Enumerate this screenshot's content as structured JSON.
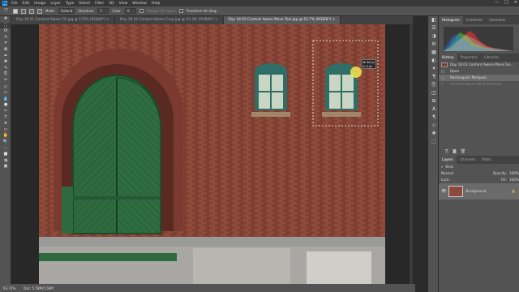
{
  "menubar": {
    "logo": "Ps",
    "items": [
      "File",
      "Edit",
      "Image",
      "Layer",
      "Type",
      "Select",
      "Filter",
      "3D",
      "View",
      "Window",
      "Help"
    ],
    "controls": [
      "—",
      "□",
      "✕"
    ]
  },
  "options": {
    "mode_label": "Mode:",
    "mode_value": "Extend",
    "structure_label": "Structure:",
    "structure_value": "7",
    "color_label": "Color:",
    "color_value": "0",
    "sample_all_layers": "Sample All Layers",
    "transform_on_drop": "Transform On Drop"
  },
  "tabs": [
    {
      "label": "Day 18 01 Content Aware Fill.jpg @ 170% (RGB/8*) ×",
      "active": false
    },
    {
      "label": "Day 18 02 Content Aware Crop.jpg @ 45.4% (RGB/8*) ×",
      "active": false
    },
    {
      "label": "Day 18 03 Content Aware Move Tool.jpg @ 63.7% (RGB/8*) ×",
      "active": true
    }
  ],
  "tools": [
    "move",
    "marquee",
    "lasso",
    "quick-select",
    "crop",
    "frame",
    "eyedropper",
    "healing",
    "brush",
    "clone",
    "history-brush",
    "eraser",
    "gradient",
    "blur",
    "dodge",
    "pen",
    "type",
    "path-select",
    "shape",
    "hand",
    "zoom",
    "more",
    "fg-bg",
    "mask",
    "screen-mode"
  ],
  "tool_glyphs": [
    "✥",
    "⬚",
    "ʘ",
    "✎",
    "⌗",
    "⊠",
    "✒",
    "✚",
    "✎",
    "⎘",
    "↶",
    "◇",
    "▭",
    "💧",
    "●",
    "✑",
    "T",
    "➤",
    "▭",
    "✋",
    "🔍",
    "…",
    "■",
    "◑",
    "▣"
  ],
  "selection_tooltip": {
    "w": "W: 84 px",
    "h": "H: 0 px"
  },
  "status": {
    "zoom": "63.72%",
    "doc": "Doc: 5.58M/5.58M"
  },
  "iconcol": [
    "◧",
    "☰",
    "◑",
    "⚙",
    "▦",
    "◐",
    "✦",
    "¶",
    "⎘",
    "◫",
    "⊞",
    "A",
    "¶",
    "◇",
    "✤",
    "⬚"
  ],
  "histogram_tabs": [
    "Histogram",
    "Gradients",
    "Swatches"
  ],
  "history_tabs": [
    "History",
    "Properties",
    "Libraries"
  ],
  "history_items": [
    {
      "label": "Day 18 03 Content Aware Move Too…",
      "type": "snapshot",
      "state": "normal"
    },
    {
      "label": "Open",
      "type": "step",
      "state": "normal"
    },
    {
      "label": "Rectangular Marquee",
      "type": "step",
      "state": "selected"
    },
    {
      "label": "Content-Aware Move Selection",
      "type": "step",
      "state": "faint"
    }
  ],
  "layers_tabs": [
    "Layers",
    "Channels",
    "Paths"
  ],
  "layers": {
    "kind_label": "Kind",
    "blend_mode": "Normal",
    "opacity_label": "Opacity:",
    "opacity_value": "100%",
    "lock_label": "Lock:",
    "fill_label": "Fill:",
    "fill_value": "100%",
    "items": [
      {
        "name": "Background",
        "locked": true
      }
    ]
  },
  "histogram_colors": [
    "#ff3030",
    "#30ff30",
    "#3070ff",
    "#c0c0c0"
  ],
  "accent": "#31a8ff"
}
